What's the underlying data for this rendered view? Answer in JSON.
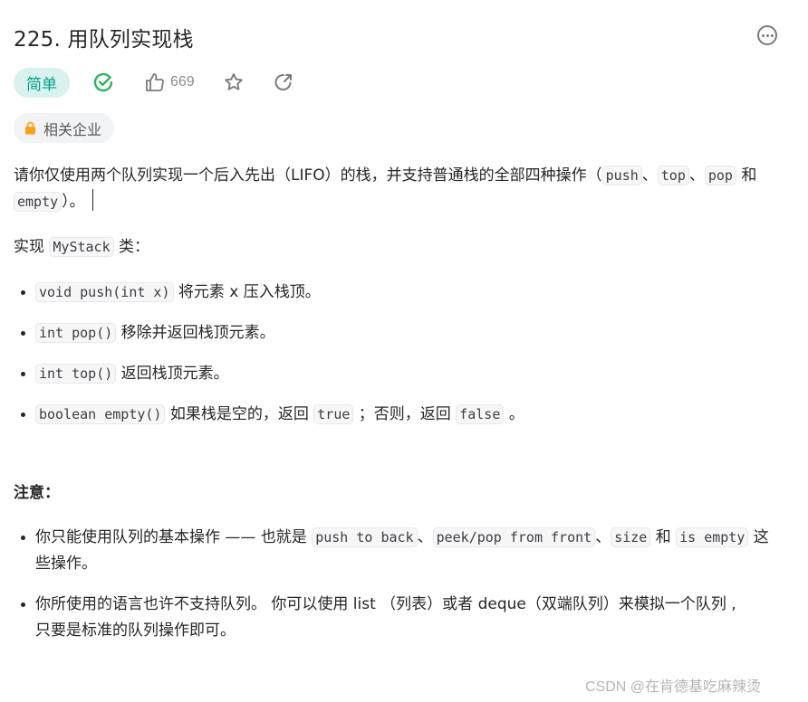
{
  "problem": {
    "title": "225. 用队列实现栈",
    "difficulty": "简单",
    "likes": "669",
    "companies_label": "相关企业"
  },
  "icons": {
    "more": "more-options-icon",
    "solved": "check-circle-icon",
    "like": "thumbs-up-icon",
    "favorite": "star-icon",
    "share": "share-icon",
    "lock": "lock-icon"
  },
  "colors": {
    "difficulty_bg": "#d7f2ef",
    "difficulty_text": "#00a08a",
    "solved": "#2db55d",
    "lock": "#ffa116"
  },
  "description": {
    "intro_parts": [
      "请你仅使用两个队列实现一个后入先出（LIFO）的栈，并支持普通栈的全部四种操作（",
      "push",
      "、",
      "top",
      "、",
      "pop",
      " 和 ",
      "empty",
      "）。"
    ],
    "implement_parts": [
      "实现 ",
      "MyStack",
      " 类："
    ],
    "api": [
      {
        "code": "void push(int x)",
        "text": " 将元素 x 压入栈顶。"
      },
      {
        "code": "int pop()",
        "text": " 移除并返回栈顶元素。"
      },
      {
        "code": "int top()",
        "text": " 返回栈顶元素。"
      },
      {
        "code": "boolean empty()",
        "text": " 如果栈是空的，返回 ",
        "code2": "true",
        "text2": " ；否则，返回 ",
        "code3": "false",
        "text3": " 。"
      }
    ]
  },
  "notes": {
    "title": "注意：",
    "items": [
      {
        "t1": "你只能使用队列的基本操作 —— 也就是 ",
        "c1": "push to back",
        "t2": "、",
        "c2": "peek/pop from front",
        "t3": "、",
        "c3": "size",
        "t4": " 和 ",
        "c4": "is empty",
        "t5": " 这些操作。"
      },
      {
        "text": "你所使用的语言也许不支持队列。 你可以使用 list （列表）或者 deque（双端队列）来模拟一个队列 , 只要是标准的队列操作即可。"
      }
    ]
  },
  "watermark": "CSDN @在肯德基吃麻辣烫"
}
